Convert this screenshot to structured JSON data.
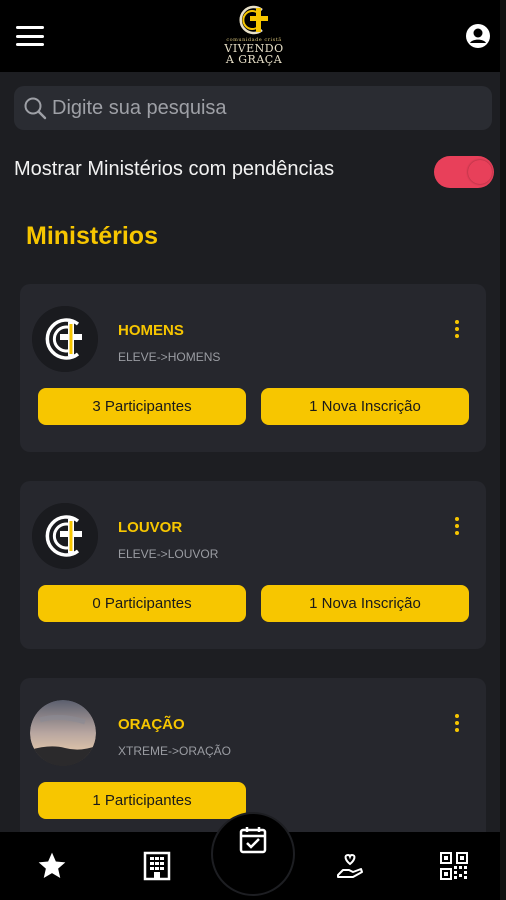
{
  "header": {
    "logo_small": "comunidade cristã",
    "logo_line1": "VIVENDO",
    "logo_line2": "A GRAÇA"
  },
  "search": {
    "placeholder": "Digite sua pesquisa"
  },
  "filter": {
    "label": "Mostrar Ministérios com pendências",
    "enabled": true
  },
  "section_title": "Ministérios",
  "ministries": [
    {
      "name": "HOMENS",
      "path": "ELEVE->HOMENS",
      "participants": "3 Participantes",
      "inscriptions": "1 Nova Inscrição"
    },
    {
      "name": "LOUVOR",
      "path": "ELEVE->LOUVOR",
      "participants": "0 Participantes",
      "inscriptions": "1 Nova Inscrição"
    },
    {
      "name": "ORAÇÃO",
      "path": "XTREME->ORAÇÃO",
      "participants": "1 Participantes"
    }
  ],
  "colors": {
    "accent": "#f7c600",
    "toggle": "#e8405a",
    "card": "#26272d",
    "background": "#1d1e22"
  },
  "bottom_nav": [
    "star-icon",
    "building-icon",
    "calendar-check-icon",
    "donate-hand-icon",
    "qr-code-icon"
  ]
}
